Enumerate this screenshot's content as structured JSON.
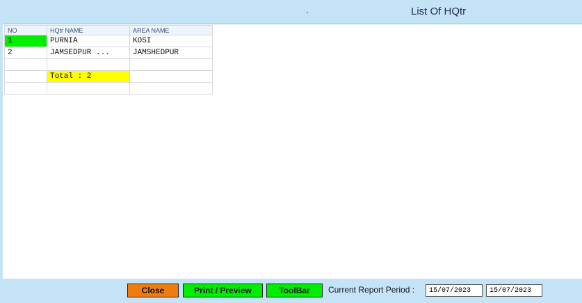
{
  "header": {
    "title": "List Of HQtr",
    "dot": "."
  },
  "table": {
    "columns": [
      "NO",
      "HQtr NAME",
      "AREA NAME"
    ],
    "rows": [
      [
        "1",
        "PURNIA",
        "KOSI"
      ],
      [
        "2",
        "JAMSEDPUR ...",
        "JAMSHEDPUR"
      ]
    ],
    "total_label": "Total : 2"
  },
  "footer": {
    "close_label": "Close",
    "print_label": "Print / Preview",
    "toolbar_label": "ToolBar",
    "period_label": "Current Report Period :",
    "date_from": "15/07/2023",
    "date_to": "15/07/2023"
  },
  "colors": {
    "background": "#c5e3f7",
    "selected_cell": "#00ee00",
    "total_cell": "#ffff00",
    "close_button": "#f07c10",
    "action_button": "#00ee00"
  }
}
